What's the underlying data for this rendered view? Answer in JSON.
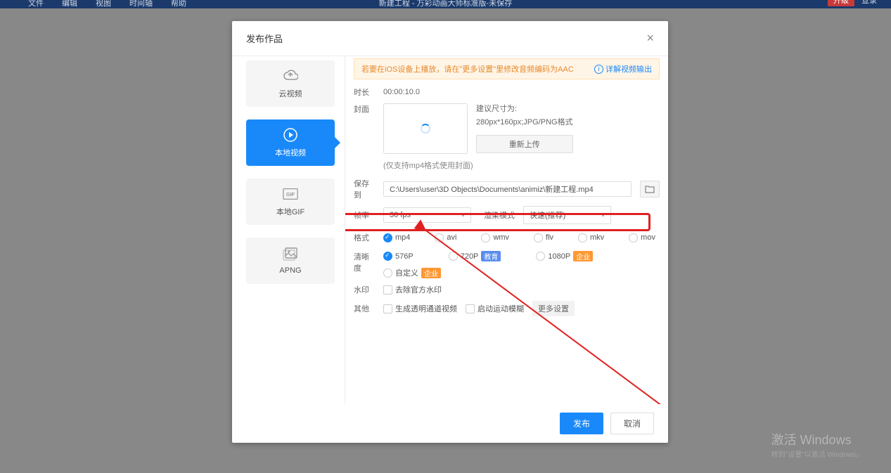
{
  "top_menu": {
    "items": [
      "文件",
      "编辑",
      "视图",
      "时间轴",
      "帮助"
    ],
    "center": "新建工程 - 万彩动画大师标准版-未保存",
    "right_btn": "升级",
    "right_link": "登录"
  },
  "dialog": {
    "title": "发布作品",
    "tip_text": "若要在iOS设备上播放，请在\"更多设置\"里修改音频编码为AAC",
    "tip_link": "详解视频输出",
    "sidebar": [
      {
        "label": "云视频"
      },
      {
        "label": "本地视频"
      },
      {
        "label": "本地GIF"
      },
      {
        "label": "APNG"
      }
    ],
    "duration_label": "时长",
    "duration_value": "00:00:10.0",
    "cover_label": "封面",
    "cover_hint_title": "建议尺寸为:",
    "cover_hint_body": "280px*160px;JPG/PNG格式",
    "reupload": "重新上传",
    "cover_note": "(仅支持mp4格式使用封面)",
    "saveto_label": "保存到",
    "save_path": "C:\\Users\\user\\3D Objects\\Documents\\animiz\\新建工程.mp4",
    "fps_label": "帧率",
    "fps_value": "30 fps",
    "render_label": "渲染模式",
    "render_value": "快速(推荐)",
    "format_label": "格式",
    "formats": [
      "mp4",
      "avi",
      "wmv",
      "flv",
      "mkv",
      "mov"
    ],
    "quality_label": "清晰度",
    "quality_opts": [
      {
        "label": "576P",
        "checked": true
      },
      {
        "label": "720P",
        "badge": "教育",
        "badgeClass": "blue"
      },
      {
        "label": "1080P",
        "badge": "企业"
      }
    ],
    "custom_label": "自定义",
    "custom_badge": "企业",
    "wm_label": "水印",
    "wm_opt": "去除官方水印",
    "other_label": "其他",
    "other_opt1": "生成透明通道视频",
    "other_opt2": "启动运动模糊",
    "more_settings": "更多设置",
    "publish": "发布",
    "cancel": "取消"
  },
  "watermark": {
    "line1": "激活 Windows",
    "line2": "转到\"设置\"以激活 Windows。"
  }
}
